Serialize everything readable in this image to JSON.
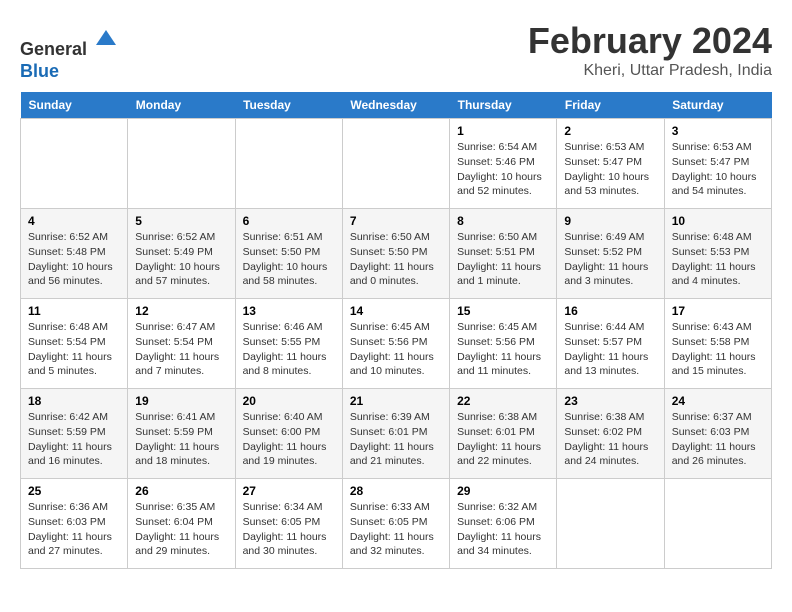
{
  "header": {
    "logo_line1": "General",
    "logo_line2": "Blue",
    "month_year": "February 2024",
    "location": "Kheri, Uttar Pradesh, India"
  },
  "weekdays": [
    "Sunday",
    "Monday",
    "Tuesday",
    "Wednesday",
    "Thursday",
    "Friday",
    "Saturday"
  ],
  "weeks": [
    [
      {
        "day": "",
        "info": ""
      },
      {
        "day": "",
        "info": ""
      },
      {
        "day": "",
        "info": ""
      },
      {
        "day": "",
        "info": ""
      },
      {
        "day": "1",
        "info": "Sunrise: 6:54 AM\nSunset: 5:46 PM\nDaylight: 10 hours and 52 minutes."
      },
      {
        "day": "2",
        "info": "Sunrise: 6:53 AM\nSunset: 5:47 PM\nDaylight: 10 hours and 53 minutes."
      },
      {
        "day": "3",
        "info": "Sunrise: 6:53 AM\nSunset: 5:47 PM\nDaylight: 10 hours and 54 minutes."
      }
    ],
    [
      {
        "day": "4",
        "info": "Sunrise: 6:52 AM\nSunset: 5:48 PM\nDaylight: 10 hours and 56 minutes."
      },
      {
        "day": "5",
        "info": "Sunrise: 6:52 AM\nSunset: 5:49 PM\nDaylight: 10 hours and 57 minutes."
      },
      {
        "day": "6",
        "info": "Sunrise: 6:51 AM\nSunset: 5:50 PM\nDaylight: 10 hours and 58 minutes."
      },
      {
        "day": "7",
        "info": "Sunrise: 6:50 AM\nSunset: 5:50 PM\nDaylight: 11 hours and 0 minutes."
      },
      {
        "day": "8",
        "info": "Sunrise: 6:50 AM\nSunset: 5:51 PM\nDaylight: 11 hours and 1 minute."
      },
      {
        "day": "9",
        "info": "Sunrise: 6:49 AM\nSunset: 5:52 PM\nDaylight: 11 hours and 3 minutes."
      },
      {
        "day": "10",
        "info": "Sunrise: 6:48 AM\nSunset: 5:53 PM\nDaylight: 11 hours and 4 minutes."
      }
    ],
    [
      {
        "day": "11",
        "info": "Sunrise: 6:48 AM\nSunset: 5:54 PM\nDaylight: 11 hours and 5 minutes."
      },
      {
        "day": "12",
        "info": "Sunrise: 6:47 AM\nSunset: 5:54 PM\nDaylight: 11 hours and 7 minutes."
      },
      {
        "day": "13",
        "info": "Sunrise: 6:46 AM\nSunset: 5:55 PM\nDaylight: 11 hours and 8 minutes."
      },
      {
        "day": "14",
        "info": "Sunrise: 6:45 AM\nSunset: 5:56 PM\nDaylight: 11 hours and 10 minutes."
      },
      {
        "day": "15",
        "info": "Sunrise: 6:45 AM\nSunset: 5:56 PM\nDaylight: 11 hours and 11 minutes."
      },
      {
        "day": "16",
        "info": "Sunrise: 6:44 AM\nSunset: 5:57 PM\nDaylight: 11 hours and 13 minutes."
      },
      {
        "day": "17",
        "info": "Sunrise: 6:43 AM\nSunset: 5:58 PM\nDaylight: 11 hours and 15 minutes."
      }
    ],
    [
      {
        "day": "18",
        "info": "Sunrise: 6:42 AM\nSunset: 5:59 PM\nDaylight: 11 hours and 16 minutes."
      },
      {
        "day": "19",
        "info": "Sunrise: 6:41 AM\nSunset: 5:59 PM\nDaylight: 11 hours and 18 minutes."
      },
      {
        "day": "20",
        "info": "Sunrise: 6:40 AM\nSunset: 6:00 PM\nDaylight: 11 hours and 19 minutes."
      },
      {
        "day": "21",
        "info": "Sunrise: 6:39 AM\nSunset: 6:01 PM\nDaylight: 11 hours and 21 minutes."
      },
      {
        "day": "22",
        "info": "Sunrise: 6:38 AM\nSunset: 6:01 PM\nDaylight: 11 hours and 22 minutes."
      },
      {
        "day": "23",
        "info": "Sunrise: 6:38 AM\nSunset: 6:02 PM\nDaylight: 11 hours and 24 minutes."
      },
      {
        "day": "24",
        "info": "Sunrise: 6:37 AM\nSunset: 6:03 PM\nDaylight: 11 hours and 26 minutes."
      }
    ],
    [
      {
        "day": "25",
        "info": "Sunrise: 6:36 AM\nSunset: 6:03 PM\nDaylight: 11 hours and 27 minutes."
      },
      {
        "day": "26",
        "info": "Sunrise: 6:35 AM\nSunset: 6:04 PM\nDaylight: 11 hours and 29 minutes."
      },
      {
        "day": "27",
        "info": "Sunrise: 6:34 AM\nSunset: 6:05 PM\nDaylight: 11 hours and 30 minutes."
      },
      {
        "day": "28",
        "info": "Sunrise: 6:33 AM\nSunset: 6:05 PM\nDaylight: 11 hours and 32 minutes."
      },
      {
        "day": "29",
        "info": "Sunrise: 6:32 AM\nSunset: 6:06 PM\nDaylight: 11 hours and 34 minutes."
      },
      {
        "day": "",
        "info": ""
      },
      {
        "day": "",
        "info": ""
      }
    ]
  ]
}
